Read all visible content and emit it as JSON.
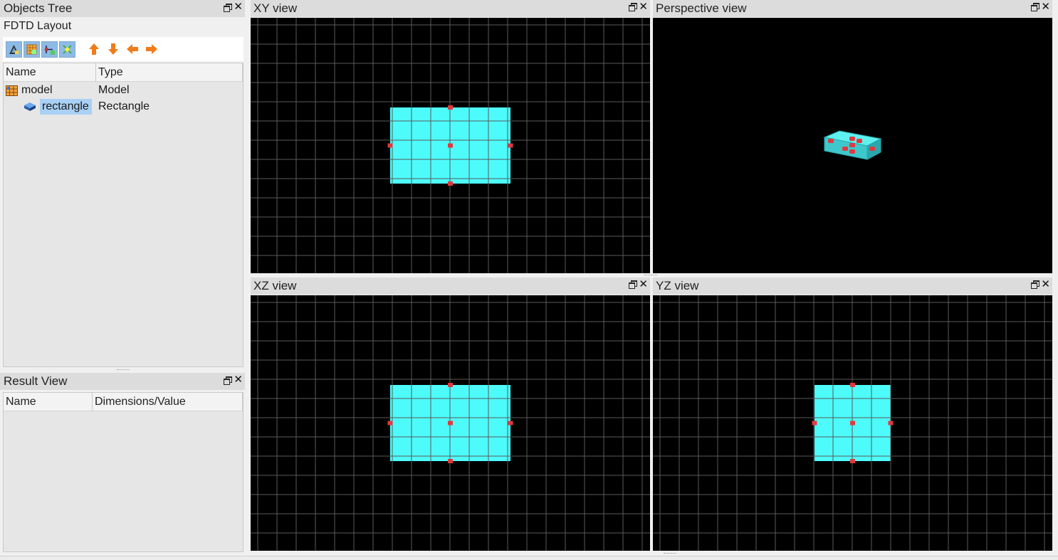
{
  "objects_tree": {
    "title": "Objects Tree",
    "layout_label": "FDTD Layout",
    "toolbar": {
      "tools": [
        "add-geometry-icon",
        "add-grid-icon",
        "add-port-icon",
        "add-probe-icon"
      ],
      "arrows": [
        "arrow-up-icon",
        "arrow-down-icon",
        "arrow-left-icon",
        "arrow-right-icon"
      ]
    },
    "columns": [
      "Name",
      "Type"
    ],
    "rows": [
      {
        "name": "model",
        "type": "Model",
        "icon": "model-icon"
      },
      {
        "name": "rectangle",
        "type": "Rectangle",
        "icon": "rectangle-object-icon",
        "selected": true
      }
    ]
  },
  "result_view": {
    "title": "Result View",
    "columns": [
      "Name",
      "Dimensions/Value"
    ]
  },
  "views": {
    "xy": {
      "title": "XY view"
    },
    "perspective": {
      "title": "Perspective view"
    },
    "xz": {
      "title": "XZ view"
    },
    "yz": {
      "title": "YZ view"
    }
  },
  "colors": {
    "object_fill": "#4dfbfb",
    "handle": "#e0393e",
    "grid_line": "#5a5a5a",
    "canvas_bg": "#000000",
    "selection": "#a9d0f5",
    "arrow": "#f07c1a"
  }
}
